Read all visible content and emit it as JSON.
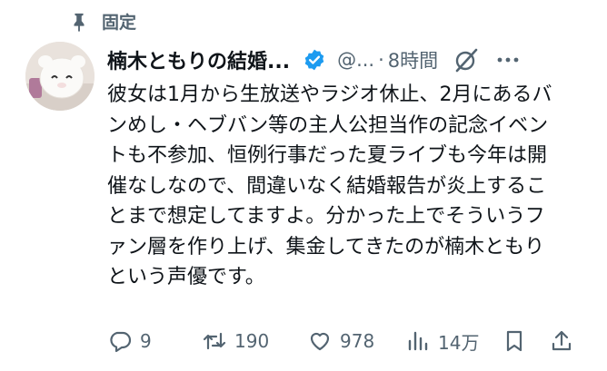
{
  "pinned": {
    "label": "固定",
    "icon": "pin-icon"
  },
  "author": {
    "display_name": "楠木ともりの結婚...",
    "handle": "@...",
    "separator": "·",
    "time": "8時間",
    "verified_color": "#1d9bf0"
  },
  "tweet": {
    "text": "彼女は1月から生放送やラジオ休止、2月にあるバンめし・ヘブバン等の主人公担当作の記念イベントも不参加、恒例行事だった夏ライブも今年は開催なしなので、間違いなく結婚報告が炎上することまで想定してますよ。分かった上でそういうファン層を作り上げ、集金してきたのが楠木ともりという声優です。"
  },
  "actions": {
    "replies": "9",
    "retweets": "190",
    "likes": "978",
    "views": "14万"
  },
  "icons": [
    "pin-icon",
    "verified-badge-icon",
    "grok-icon",
    "more-icon",
    "reply-icon",
    "retweet-icon",
    "like-icon",
    "views-icon",
    "bookmark-icon",
    "share-icon"
  ],
  "colors": {
    "text": "#0f1419",
    "secondary": "#536471",
    "accent": "#1d9bf0"
  }
}
